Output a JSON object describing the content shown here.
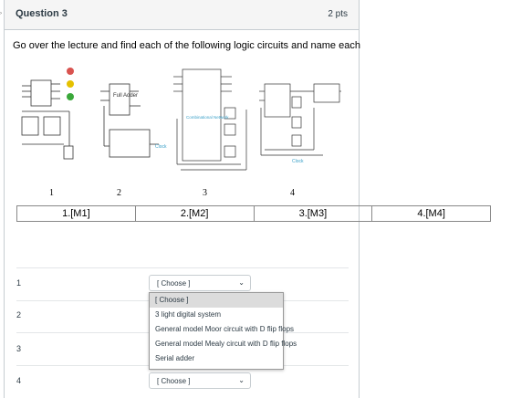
{
  "question": {
    "title": "Question 3",
    "points": "2 pts",
    "prompt": "Go over the lecture and find each of the following logic circuits and name each"
  },
  "figures": {
    "numbers": [
      "1",
      "2",
      "3",
      "4"
    ],
    "full_adder_label": "Full Adder",
    "clock_label": "Clock",
    "comb_label": "Combinational Network"
  },
  "mapping_row": [
    "1.[M1]",
    "2.[M2]",
    "3.[M3]",
    "4.[M4]"
  ],
  "matches": [
    {
      "label": "1",
      "value": "[ Choose ]"
    },
    {
      "label": "2",
      "value": ""
    },
    {
      "label": "3",
      "value": ""
    },
    {
      "label": "4",
      "value": "[ Choose ]"
    }
  ],
  "dropdown": {
    "options": [
      "[ Choose ]",
      "3 light digital system",
      "General model Moor circuit with D flip flops",
      "General model Mealy circuit with D flip flops",
      "Serial adder"
    ],
    "selected_index": 0
  },
  "colors": {
    "header_bg": "#f5f5f5",
    "border": "#c7cdd1",
    "diagram": "#3aa0c8"
  }
}
